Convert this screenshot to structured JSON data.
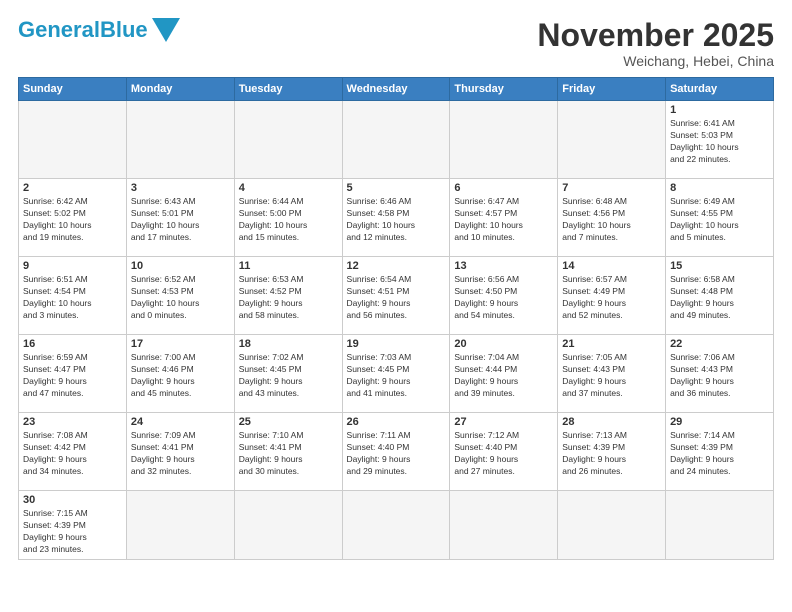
{
  "header": {
    "logo_general": "General",
    "logo_blue": "Blue",
    "month_year": "November 2025",
    "location": "Weichang, Hebei, China"
  },
  "weekdays": [
    "Sunday",
    "Monday",
    "Tuesday",
    "Wednesday",
    "Thursday",
    "Friday",
    "Saturday"
  ],
  "weeks": [
    [
      {
        "day": "",
        "info": ""
      },
      {
        "day": "",
        "info": ""
      },
      {
        "day": "",
        "info": ""
      },
      {
        "day": "",
        "info": ""
      },
      {
        "day": "",
        "info": ""
      },
      {
        "day": "",
        "info": ""
      },
      {
        "day": "1",
        "info": "Sunrise: 6:41 AM\nSunset: 5:03 PM\nDaylight: 10 hours\nand 22 minutes."
      }
    ],
    [
      {
        "day": "2",
        "info": "Sunrise: 6:42 AM\nSunset: 5:02 PM\nDaylight: 10 hours\nand 19 minutes."
      },
      {
        "day": "3",
        "info": "Sunrise: 6:43 AM\nSunset: 5:01 PM\nDaylight: 10 hours\nand 17 minutes."
      },
      {
        "day": "4",
        "info": "Sunrise: 6:44 AM\nSunset: 5:00 PM\nDaylight: 10 hours\nand 15 minutes."
      },
      {
        "day": "5",
        "info": "Sunrise: 6:46 AM\nSunset: 4:58 PM\nDaylight: 10 hours\nand 12 minutes."
      },
      {
        "day": "6",
        "info": "Sunrise: 6:47 AM\nSunset: 4:57 PM\nDaylight: 10 hours\nand 10 minutes."
      },
      {
        "day": "7",
        "info": "Sunrise: 6:48 AM\nSunset: 4:56 PM\nDaylight: 10 hours\nand 7 minutes."
      },
      {
        "day": "8",
        "info": "Sunrise: 6:49 AM\nSunset: 4:55 PM\nDaylight: 10 hours\nand 5 minutes."
      }
    ],
    [
      {
        "day": "9",
        "info": "Sunrise: 6:51 AM\nSunset: 4:54 PM\nDaylight: 10 hours\nand 3 minutes."
      },
      {
        "day": "10",
        "info": "Sunrise: 6:52 AM\nSunset: 4:53 PM\nDaylight: 10 hours\nand 0 minutes."
      },
      {
        "day": "11",
        "info": "Sunrise: 6:53 AM\nSunset: 4:52 PM\nDaylight: 9 hours\nand 58 minutes."
      },
      {
        "day": "12",
        "info": "Sunrise: 6:54 AM\nSunset: 4:51 PM\nDaylight: 9 hours\nand 56 minutes."
      },
      {
        "day": "13",
        "info": "Sunrise: 6:56 AM\nSunset: 4:50 PM\nDaylight: 9 hours\nand 54 minutes."
      },
      {
        "day": "14",
        "info": "Sunrise: 6:57 AM\nSunset: 4:49 PM\nDaylight: 9 hours\nand 52 minutes."
      },
      {
        "day": "15",
        "info": "Sunrise: 6:58 AM\nSunset: 4:48 PM\nDaylight: 9 hours\nand 49 minutes."
      }
    ],
    [
      {
        "day": "16",
        "info": "Sunrise: 6:59 AM\nSunset: 4:47 PM\nDaylight: 9 hours\nand 47 minutes."
      },
      {
        "day": "17",
        "info": "Sunrise: 7:00 AM\nSunset: 4:46 PM\nDaylight: 9 hours\nand 45 minutes."
      },
      {
        "day": "18",
        "info": "Sunrise: 7:02 AM\nSunset: 4:45 PM\nDaylight: 9 hours\nand 43 minutes."
      },
      {
        "day": "19",
        "info": "Sunrise: 7:03 AM\nSunset: 4:45 PM\nDaylight: 9 hours\nand 41 minutes."
      },
      {
        "day": "20",
        "info": "Sunrise: 7:04 AM\nSunset: 4:44 PM\nDaylight: 9 hours\nand 39 minutes."
      },
      {
        "day": "21",
        "info": "Sunrise: 7:05 AM\nSunset: 4:43 PM\nDaylight: 9 hours\nand 37 minutes."
      },
      {
        "day": "22",
        "info": "Sunrise: 7:06 AM\nSunset: 4:43 PM\nDaylight: 9 hours\nand 36 minutes."
      }
    ],
    [
      {
        "day": "23",
        "info": "Sunrise: 7:08 AM\nSunset: 4:42 PM\nDaylight: 9 hours\nand 34 minutes."
      },
      {
        "day": "24",
        "info": "Sunrise: 7:09 AM\nSunset: 4:41 PM\nDaylight: 9 hours\nand 32 minutes."
      },
      {
        "day": "25",
        "info": "Sunrise: 7:10 AM\nSunset: 4:41 PM\nDaylight: 9 hours\nand 30 minutes."
      },
      {
        "day": "26",
        "info": "Sunrise: 7:11 AM\nSunset: 4:40 PM\nDaylight: 9 hours\nand 29 minutes."
      },
      {
        "day": "27",
        "info": "Sunrise: 7:12 AM\nSunset: 4:40 PM\nDaylight: 9 hours\nand 27 minutes."
      },
      {
        "day": "28",
        "info": "Sunrise: 7:13 AM\nSunset: 4:39 PM\nDaylight: 9 hours\nand 26 minutes."
      },
      {
        "day": "29",
        "info": "Sunrise: 7:14 AM\nSunset: 4:39 PM\nDaylight: 9 hours\nand 24 minutes."
      }
    ],
    [
      {
        "day": "30",
        "info": "Sunrise: 7:15 AM\nSunset: 4:39 PM\nDaylight: 9 hours\nand 23 minutes."
      },
      {
        "day": "",
        "info": ""
      },
      {
        "day": "",
        "info": ""
      },
      {
        "day": "",
        "info": ""
      },
      {
        "day": "",
        "info": ""
      },
      {
        "day": "",
        "info": ""
      },
      {
        "day": "",
        "info": ""
      }
    ]
  ]
}
